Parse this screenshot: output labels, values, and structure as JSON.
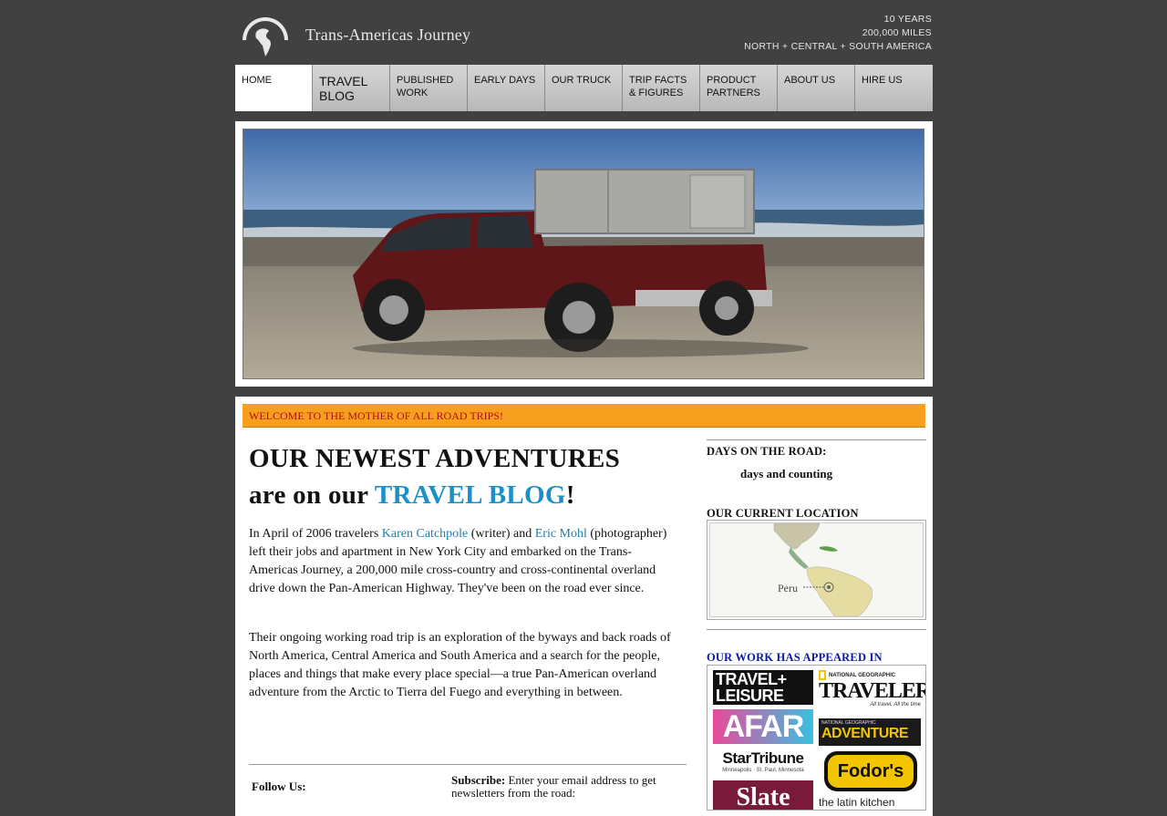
{
  "header": {
    "site_title": "Trans-Americas Journey",
    "tagline": [
      "10 YEARS",
      "200,000 MILES",
      "NORTH + CENTRAL + SOUTH AMERICA"
    ]
  },
  "nav": [
    {
      "label": "HOME"
    },
    {
      "label": "TRAVEL\nBLOG"
    },
    {
      "label": "PUBLISHED\nWORK"
    },
    {
      "label": "EARLY DAYS"
    },
    {
      "label": "OUR TRUCK"
    },
    {
      "label": "TRIP FACTS\n   & FIGURES"
    },
    {
      "label": "PRODUCT\nPARTNERS"
    },
    {
      "label": "ABOUT US"
    },
    {
      "label": "HIRE US"
    }
  ],
  "welcome": "WELCOME TO THE MOTHER OF ALL ROAD TRIPS!",
  "headline": {
    "line1": "OUR NEWEST ADVENTURES",
    "line2_prefix": "are on our ",
    "line2_link": "TRAVEL BLOG",
    "line2_suffix": "!"
  },
  "intro": {
    "p1_a": "In April of 2006 travelers ",
    "p1_link1": "Karen Catchpole",
    "p1_b": " (writer) and ",
    "p1_link2": "Eric Mohl",
    "p1_c": " (photographer) left their jobs and apartment in New York City and embarked on the Trans-Americas Journey, a 200,000 mile cross-country and cross-continental overland drive down the Pan-American Highway. They've been on the road ever since.",
    "p2": "Their ongoing working road trip is an exploration of the byways and back roads of North America, Central America and South America and a search for the people, places and things that make every place special—a true Pan-American overland adventure from the Arctic to Tierra del Fuego and everything in between."
  },
  "follow_label": "Follow Us:",
  "subscribe": {
    "label": "Subscribe:",
    "text": " Enter your email address to get newsletters from the road:"
  },
  "sidebar": {
    "days_head": "DAYS ON THE ROAD:",
    "days_sub": "days and counting",
    "location_head": "OUR CURRENT LOCATION",
    "location_label": "Peru",
    "work_head": "OUR WORK HAS APPEARED IN"
  },
  "logos": {
    "travel_leisure_1": "TRAVEL+",
    "travel_leisure_2": "LEISURE",
    "natgeo": "NATIONAL GEOGRAPHIC",
    "traveler": "TRAVELER",
    "traveler_sub": "All travel, All the time",
    "afar": "AFAR",
    "adventure_top": "NATIONAL GEOGRAPHIC",
    "adventure": "ADVENTURE",
    "startribune": "StarTribune",
    "startribune_sub": "Minneapolis · St. Paul, Minnesota",
    "fodors": "Fodor's",
    "slate": "Slate",
    "latin_kitchen": "the latin kitchen"
  },
  "colors": {
    "page_bg": "#414141",
    "welcome_bar": "#f7a020",
    "link_blue": "#1a8fc8",
    "work_head": "#0a1aa0"
  }
}
